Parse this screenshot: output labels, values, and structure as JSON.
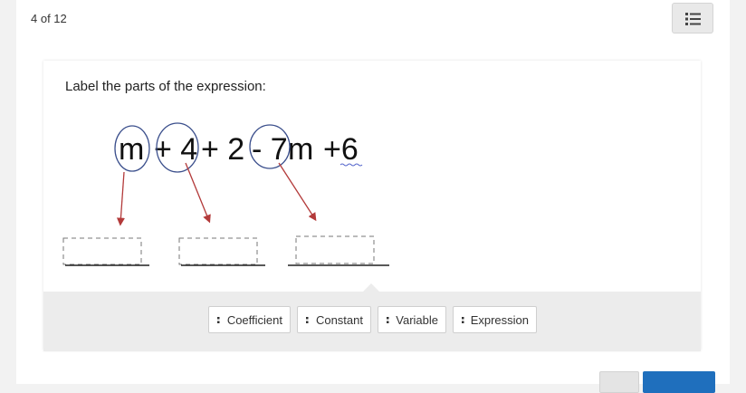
{
  "header": {
    "counter": "4 of 12"
  },
  "question": {
    "prompt": "Label the parts of the expression:",
    "expression_parts": [
      "m",
      "+ 4",
      "+ 2",
      "- 7",
      "m",
      "+6"
    ]
  },
  "word_bank": {
    "chips": [
      "Coefficient",
      "Constant",
      "Variable",
      "Expression"
    ]
  },
  "colors": {
    "primary": "#1f6fbd",
    "arrow": "#b33a3a",
    "circle": "#3b4f8c"
  }
}
